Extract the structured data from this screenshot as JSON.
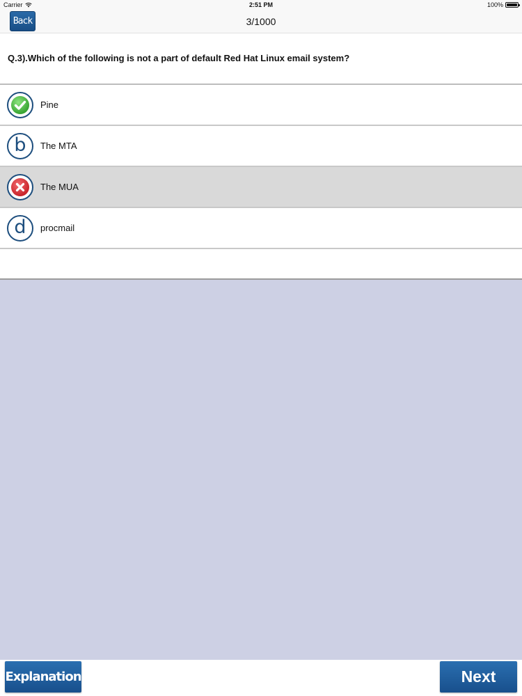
{
  "status_bar": {
    "carrier": "Carrier",
    "time": "2:51 PM",
    "battery": "100%"
  },
  "nav": {
    "back_label": "Back",
    "title": "3/1000"
  },
  "question": {
    "text": "Q.3).Which of the following is not a part of default Red Hat Linux email system?"
  },
  "options": [
    {
      "letter": "a",
      "text": "Pine",
      "state": "correct",
      "icon": "check-icon"
    },
    {
      "letter": "b",
      "text": "The MTA",
      "state": "unselected",
      "icon": "letter-b-icon"
    },
    {
      "letter": "c",
      "text": "The MUA",
      "state": "wrong-selected",
      "icon": "x-icon"
    },
    {
      "letter": "d",
      "text": "procmail",
      "state": "unselected",
      "icon": "letter-d-icon"
    }
  ],
  "bottom": {
    "explanation_label": "Explanation",
    "next_label": "Next"
  },
  "colors": {
    "accent_blue": "#1d4e7e",
    "button_blue": "#215f9e",
    "content_background": "#cdd0e4",
    "selected_row": "#d9d9d9",
    "correct_green": "#3fb83a",
    "wrong_red": "#d8262b"
  }
}
